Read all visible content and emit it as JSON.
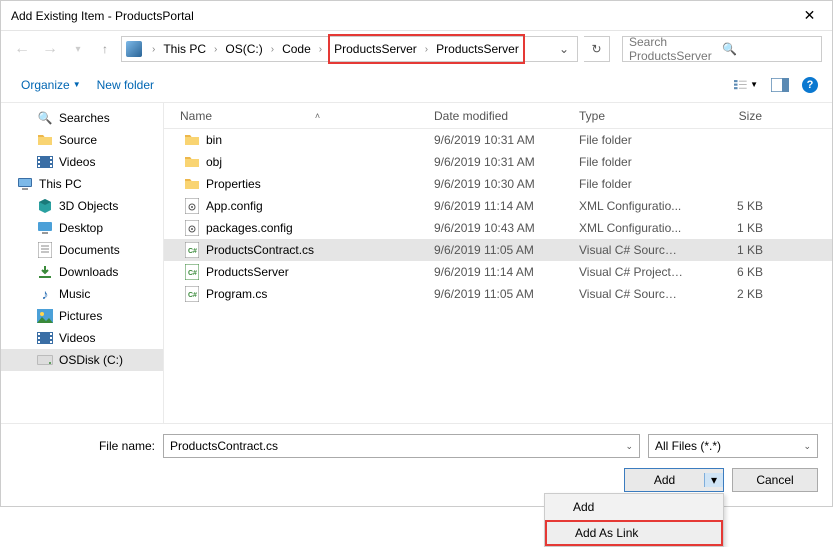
{
  "window": {
    "title": "Add Existing Item - ProductsPortal"
  },
  "breadcrumb": {
    "root": "This PC",
    "parts": [
      "OS(C:)",
      "Code",
      "ProductsServer",
      "ProductsServer"
    ]
  },
  "search": {
    "placeholder": "Search ProductsServer"
  },
  "toolbar": {
    "organize": "Organize",
    "newfolder": "New folder"
  },
  "sidebar": {
    "items": [
      {
        "label": "Searches",
        "icon": "search"
      },
      {
        "label": "Source",
        "icon": "folder"
      },
      {
        "label": "Videos",
        "icon": "videos"
      },
      {
        "label": "This PC",
        "icon": "pc",
        "level": 1
      },
      {
        "label": "3D Objects",
        "icon": "3d"
      },
      {
        "label": "Desktop",
        "icon": "desktop"
      },
      {
        "label": "Documents",
        "icon": "docs"
      },
      {
        "label": "Downloads",
        "icon": "downloads"
      },
      {
        "label": "Music",
        "icon": "music"
      },
      {
        "label": "Pictures",
        "icon": "pictures"
      },
      {
        "label": "Videos",
        "icon": "videos"
      },
      {
        "label": "OSDisk (C:)",
        "icon": "disk",
        "selected": true
      }
    ]
  },
  "columns": {
    "name": "Name",
    "date": "Date modified",
    "type": "Type",
    "size": "Size"
  },
  "files": [
    {
      "name": "bin",
      "date": "9/6/2019 10:31 AM",
      "type": "File folder",
      "size": "",
      "icon": "folder"
    },
    {
      "name": "obj",
      "date": "9/6/2019 10:31 AM",
      "type": "File folder",
      "size": "",
      "icon": "folder"
    },
    {
      "name": "Properties",
      "date": "9/6/2019 10:30 AM",
      "type": "File folder",
      "size": "",
      "icon": "folder"
    },
    {
      "name": "App.config",
      "date": "9/6/2019 11:14 AM",
      "type": "XML Configuratio...",
      "size": "5 KB",
      "icon": "cfg"
    },
    {
      "name": "packages.config",
      "date": "9/6/2019 10:43 AM",
      "type": "XML Configuratio...",
      "size": "1 KB",
      "icon": "cfg"
    },
    {
      "name": "ProductsContract.cs",
      "date": "9/6/2019 11:05 AM",
      "type": "Visual C# Source F...",
      "size": "1 KB",
      "icon": "cs",
      "selected": true
    },
    {
      "name": "ProductsServer",
      "date": "9/6/2019 11:14 AM",
      "type": "Visual C# Project f...",
      "size": "6 KB",
      "icon": "csproj"
    },
    {
      "name": "Program.cs",
      "date": "9/6/2019 11:05 AM",
      "type": "Visual C# Source F...",
      "size": "2 KB",
      "icon": "cs"
    }
  ],
  "footer": {
    "filename_label": "File name:",
    "filename_value": "ProductsContract.cs",
    "filter": "All Files (*.*)",
    "add": "Add",
    "cancel": "Cancel",
    "dropdown": {
      "add": "Add",
      "addaslink": "Add As Link"
    }
  }
}
